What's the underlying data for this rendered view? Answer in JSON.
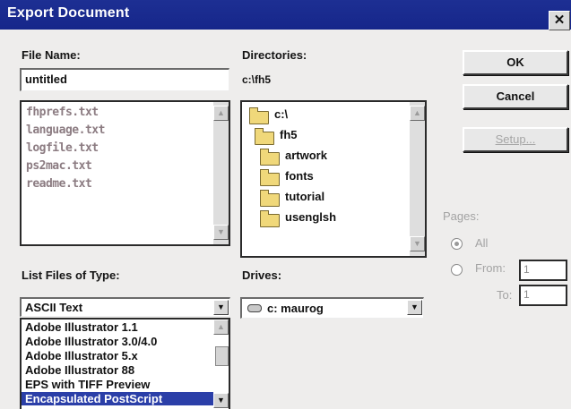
{
  "window": {
    "title": "Export Document",
    "close_glyph": "✕"
  },
  "file_name": {
    "label": "File Name:",
    "value": "untitled"
  },
  "file_list": [
    "fhprefs.txt",
    "language.txt",
    "logfile.txt",
    "ps2mac.txt",
    "readme.txt"
  ],
  "directories": {
    "label": "Directories:",
    "current_path": "c:\\fh5",
    "tree": [
      {
        "name": "c:\\",
        "icon": "open-folder-icon"
      },
      {
        "name": "fh5",
        "icon": "open-folder-icon"
      },
      {
        "name": "artwork",
        "icon": "folder-icon"
      },
      {
        "name": "fonts",
        "icon": "folder-icon"
      },
      {
        "name": "tutorial",
        "icon": "folder-icon"
      },
      {
        "name": "usenglsh",
        "icon": "folder-icon"
      }
    ]
  },
  "buttons": {
    "ok": "OK",
    "cancel": "Cancel",
    "setup": "Setup..."
  },
  "list_files_of_type": {
    "label": "List Files of Type:",
    "selected": "ASCII Text",
    "options": [
      "Adobe Illustrator 1.1",
      "Adobe Illustrator 3.0/4.0",
      "Adobe Illustrator 5.x",
      "Adobe Illustrator 88",
      "EPS with TIFF Preview",
      "Encapsulated PostScript"
    ],
    "highlighted_option": "Encapsulated PostScript"
  },
  "drives": {
    "label": "Drives:",
    "selected": "c: maurog",
    "icon": "drive-icon"
  },
  "pages": {
    "label": "Pages:",
    "all_label": "All",
    "from_label": "From:",
    "to_label": "To:",
    "from_value": "1",
    "to_value": "1",
    "selected": "All"
  },
  "colors": {
    "titlebar": "#16268a",
    "selection": "#2b3fa8",
    "dialog": "#eeedec"
  }
}
